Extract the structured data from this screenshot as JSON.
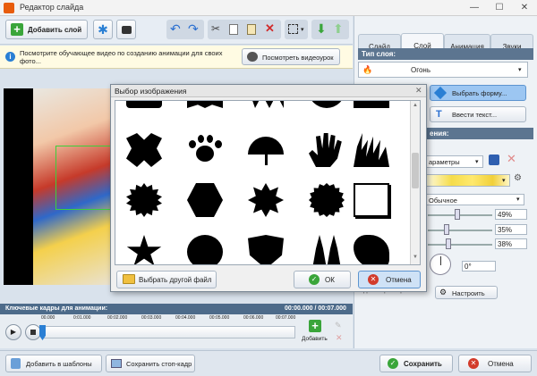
{
  "window": {
    "title": "Редактор слайда",
    "minimize": "—",
    "maximize": "☐",
    "close": "✕"
  },
  "toolbar": {
    "add_layer": "Добавить слой"
  },
  "notice": {
    "text": "Посмотрите обучающее видео по созданию анимации для своих фото...",
    "button": "Посмотреть видеоурок"
  },
  "tabs": [
    "Слайд",
    "Слой",
    "Анимация",
    "Звуки"
  ],
  "layer_panel": {
    "type_header": "Тип слоя:",
    "type_value": "Огонь",
    "choose_shape": "Выбрать форму...",
    "enter_text": "Ввести текст...",
    "section_fragment": "ения:",
    "params_value": "араметры",
    "blend_value": "Обычное",
    "percents": [
      "49%",
      "35%",
      "38%"
    ],
    "angle": "0°",
    "configure": "Настроить",
    "partial_label": "Дать параметры"
  },
  "timeline": {
    "header": "Ключевые кадры для анимации:",
    "time": "00:00.000 / 00:07.000",
    "ticks": [
      "00.000",
      "0:01.000",
      "00:02.000",
      "00:03.000",
      "00:04.000",
      "00:05.000",
      "00:06.000",
      "00:07.000"
    ],
    "add_label": "Добавить"
  },
  "dialog": {
    "title": "Выбор изображения",
    "other_file": "Выбрать другой файл",
    "ok": "ОК",
    "cancel": "Отмена"
  },
  "bottom": {
    "add_templates": "Добавить в шаблоны",
    "save_frame": "Сохранить стоп-кадр",
    "save": "Сохранить",
    "cancel": "Отмена"
  },
  "colors": {
    "accent": "#5c7590",
    "selected": "#7fb0e8",
    "ok_green": "#3aa53a",
    "cancel_red": "#d23b2b"
  }
}
